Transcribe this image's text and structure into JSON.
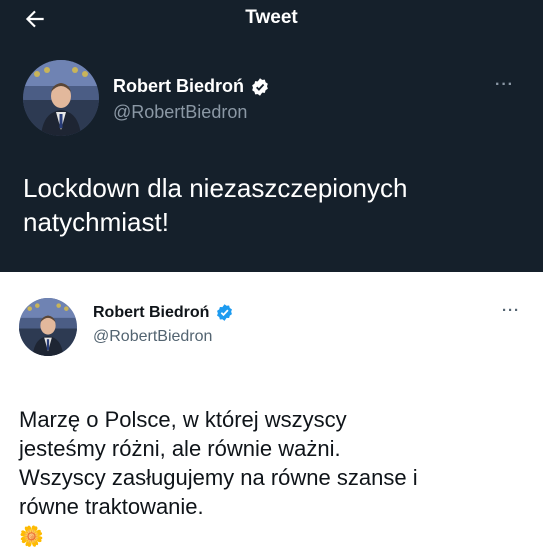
{
  "header": {
    "title": "Tweet",
    "back_icon": "arrow-left-icon"
  },
  "tweet_dark": {
    "author_name": "Robert Biedroń",
    "author_handle": "@RobertBiedron",
    "more_label": "···",
    "text": "Lockdown dla niezaszczepionych\nnatychmiast!",
    "verified_icon": "verified-badge-icon"
  },
  "tweet_light": {
    "author_name": "Robert Biedroń",
    "author_handle": "@RobertBiedron",
    "more_label": "···",
    "text": "Marzę o Polsce, w której wszyscy\njesteśmy różni, ale równie ważni.\nWszyscy zasługujemy na równe szanse i\nrówne traktowanie.",
    "emoji": "🌼",
    "verified_icon": "verified-badge-icon"
  },
  "colors": {
    "dark_background": "#15202b",
    "dark_secondary": "#8b98a5",
    "light_secondary": "#536471",
    "verified_dark": "#ffffff",
    "verified_light": "#1d9bf0"
  }
}
